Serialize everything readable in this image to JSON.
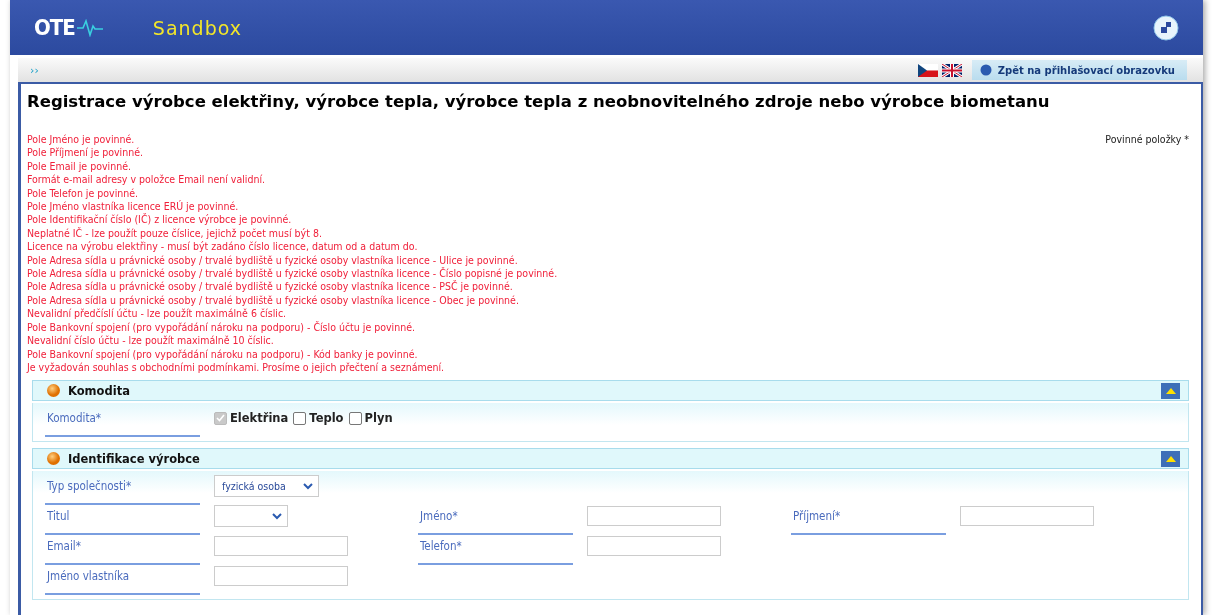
{
  "header": {
    "logo": "OTE",
    "environment": "Sandbox"
  },
  "nav": {
    "breadcrumb": "››",
    "back_button": "Zpět na přihlašovací obrazovku"
  },
  "title": "Registrace výrobce elektřiny, výrobce tepla, výrobce tepla z neobnovitelného zdroje nebo výrobce biometanu",
  "required_note": "Povinné položky *",
  "errors": [
    "Pole Jméno je povinné.",
    "Pole Příjmení je povinné.",
    "Pole Email je povinné.",
    "Formát e-mail adresy v položce Email není validní.",
    "Pole Telefon je povinné.",
    "Pole Jméno vlastníka licence ERÚ je povinné.",
    "Pole Identifikační číslo (IČ) z licence výrobce je povinné.",
    "Neplatné IČ - lze použít pouze číslice, jejichž počet musí být 8.",
    "Licence na výrobu elektřiny - musí být zadáno číslo licence, datum od a datum do.",
    "Pole Adresa sídla u právnické osoby / trvalé bydliště u fyzické osoby vlastníka licence - Ulice je povinné.",
    "Pole Adresa sídla u právnické osoby / trvalé bydliště u fyzické osoby vlastníka licence - Číslo popisné je povinné.",
    "Pole Adresa sídla u právnické osoby / trvalé bydliště u fyzické osoby vlastníka licence - PSČ je povinné.",
    "Pole Adresa sídla u právnické osoby / trvalé bydliště u fyzické osoby vlastníka licence - Obec je povinné.",
    "Nevalidní předčíslí účtu - lze použít maximálně 6 číslic.",
    "Pole Bankovní spojení (pro vypořádání nároku na podporu) - Číslo účtu je povinné.",
    "Nevalidní číslo účtu - lze použít maximálně 10 číslic.",
    "Pole Bankovní spojení (pro vypořádání nároku na podporu) - Kód banky je povinné.",
    "Je vyžadován souhlas s obchodními podmínkami. Prosíme o jejich přečtení a seznámení."
  ],
  "sections": [
    {
      "title": "Komodita",
      "expanded": true,
      "rows": [
        [
          {
            "label": "Komodita*",
            "kind": "checkboxes",
            "options": [
              {
                "label": "Elektřina",
                "checked": true,
                "disabled": true
              },
              {
                "label": "Teplo",
                "checked": false,
                "disabled": false
              },
              {
                "label": "Plyn",
                "checked": false,
                "disabled": false
              }
            ]
          }
        ]
      ]
    },
    {
      "title": "Identifikace výrobce",
      "expanded": true,
      "rows": [
        [
          {
            "label": "Typ společnosti*",
            "kind": "select",
            "value": "fyzická osoba"
          }
        ],
        [
          {
            "label": "Titul",
            "kind": "select"
          },
          {
            "label": "Jméno*",
            "kind": "text"
          },
          {
            "label": "Příjmení*",
            "kind": "text"
          }
        ],
        [
          {
            "label": "Email*",
            "kind": "text"
          },
          {
            "label": "Telefon*",
            "kind": "text"
          }
        ],
        [
          {
            "label": "Jméno vlastníka",
            "kind": "text"
          }
        ]
      ]
    }
  ]
}
